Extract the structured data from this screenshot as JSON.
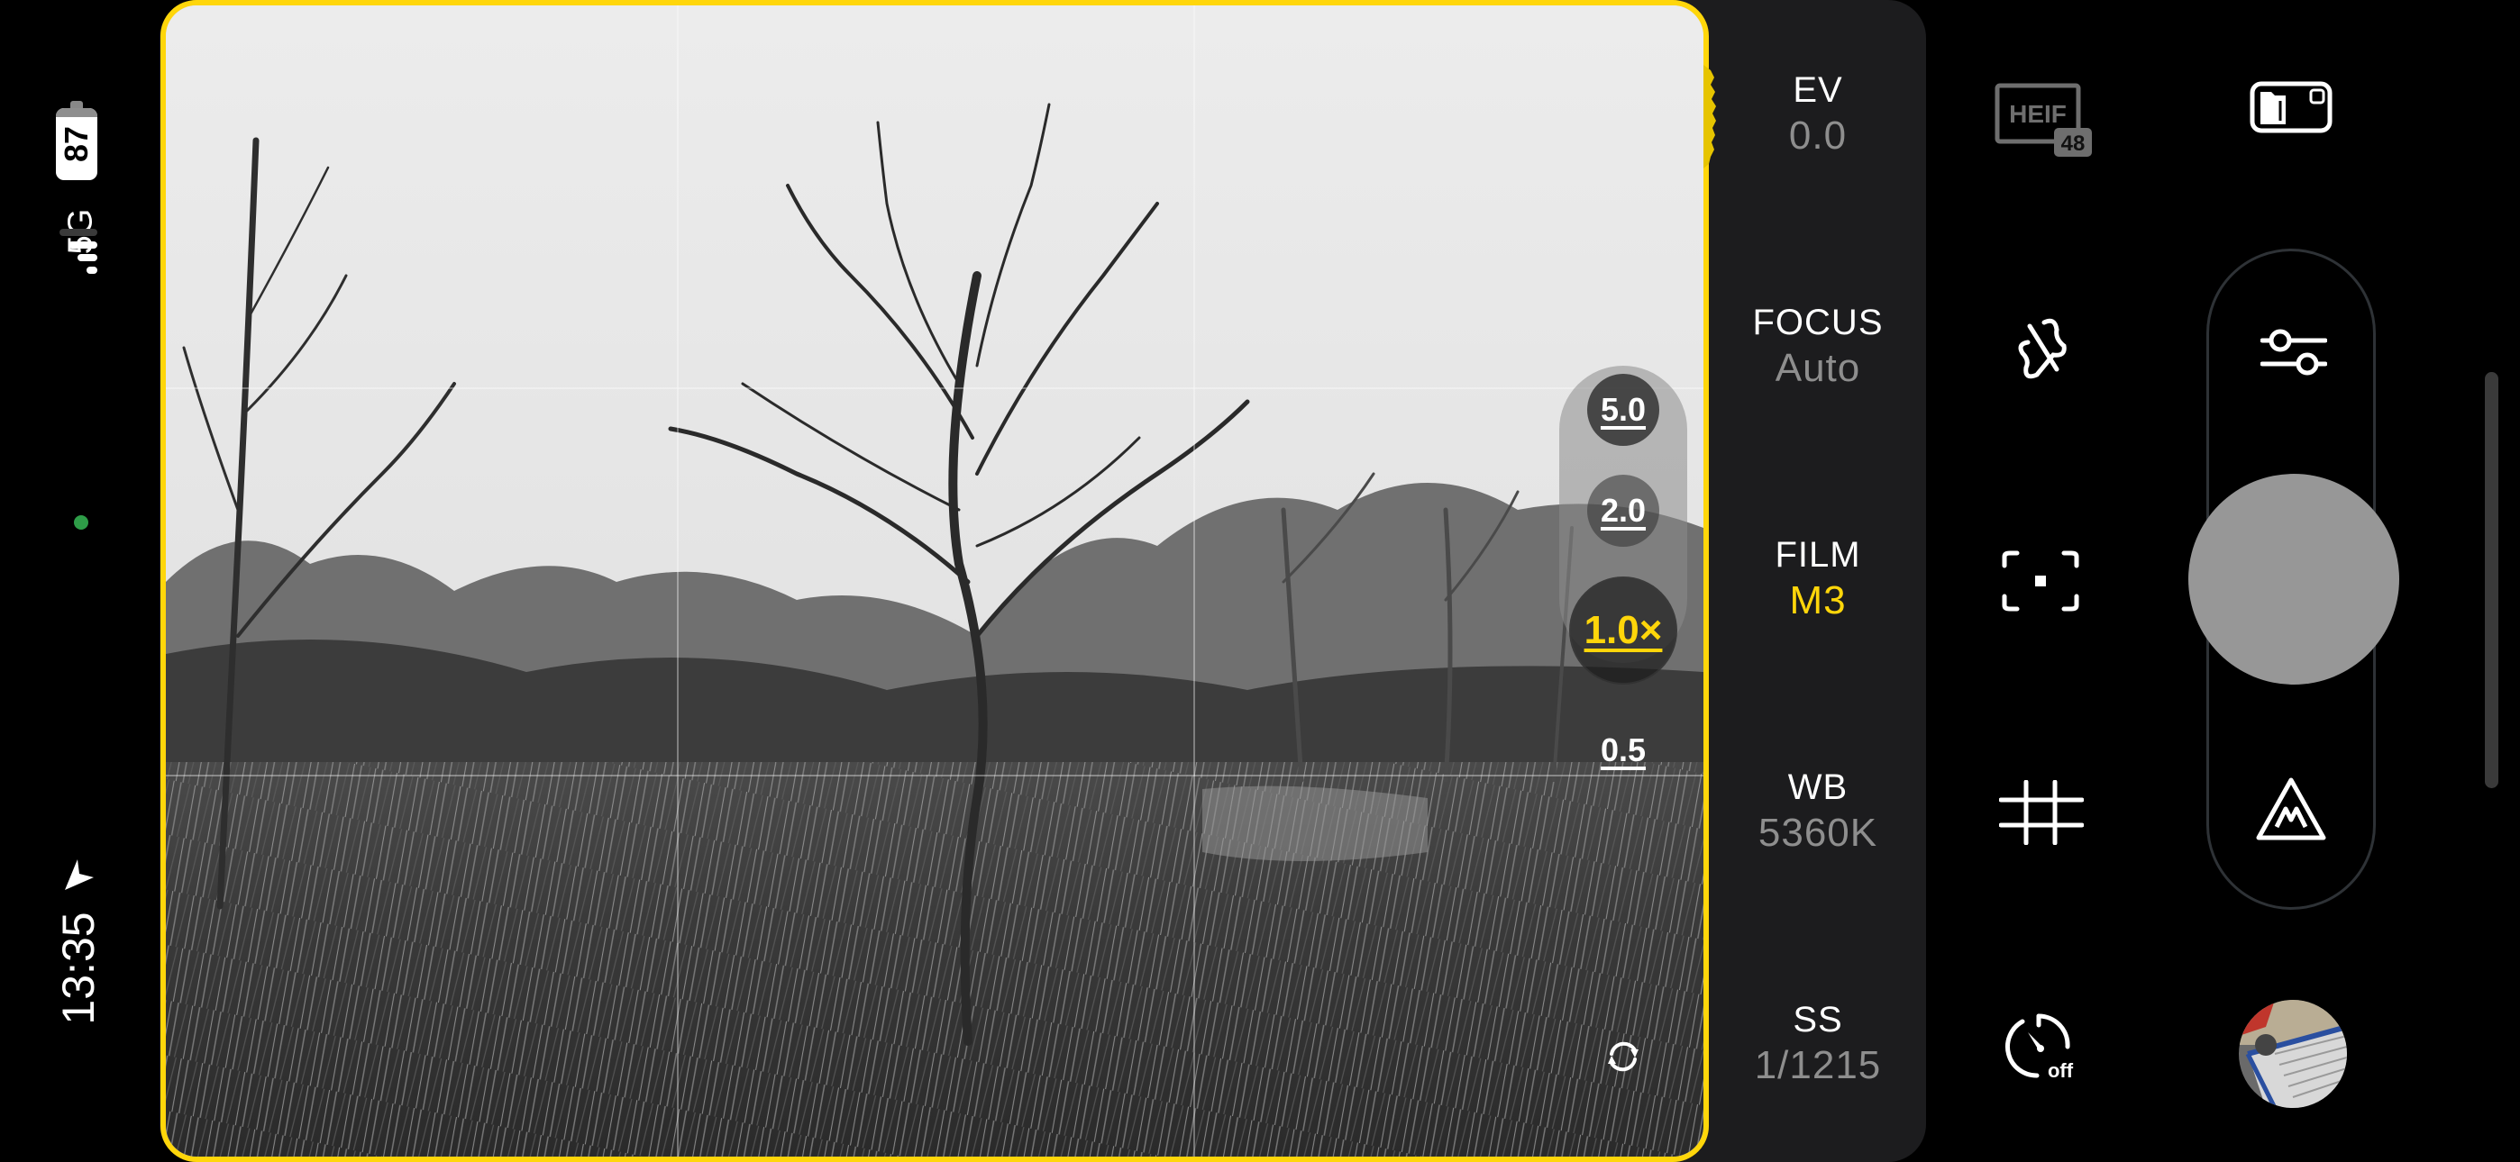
{
  "status_bar": {
    "battery_level": "87",
    "battery_fraction": 0.87,
    "network": "5G",
    "signal_bars_active": 3,
    "signal_bars_total": 4,
    "privacy_indicator_color": "#2e9d48",
    "time": "13:35",
    "location_icon": "location-arrow-icon"
  },
  "viewfinder": {
    "border_color": "#ffd60a",
    "grid": "3x3",
    "scene": "black-and-white winter landscape with bare tree in tall grass"
  },
  "zoom_selector": {
    "options": [
      {
        "label": "5.0",
        "active": false
      },
      {
        "label": "2.0",
        "active": false
      },
      {
        "label": "1.0×",
        "active": true
      },
      {
        "label": "0.5",
        "active": false
      }
    ],
    "active_color": "#ffd60a"
  },
  "flip_camera": {
    "icon": "switch-camera-icon"
  },
  "settings": [
    {
      "label": "EV",
      "value": "0.0",
      "active": false
    },
    {
      "label": "FOCUS",
      "value": "Auto",
      "active": false
    },
    {
      "label": "FILM",
      "value": "M3",
      "active": true
    },
    {
      "label": "WB",
      "value": "5360K",
      "active": false
    },
    {
      "label": "SS",
      "value": "1/1215",
      "active": false
    }
  ],
  "controls": {
    "format_badge": {
      "label": "HEIF",
      "sub": "48"
    },
    "storage_toggle": {
      "icon": "storage-toggle-icon"
    },
    "flash": {
      "icon": "flash-off-icon"
    },
    "focus_mode": {
      "icon": "focus-frame-icon"
    },
    "grid": {
      "icon": "grid-icon"
    },
    "timer": {
      "icon": "timer-icon",
      "label": "off"
    },
    "adjust": {
      "icon": "sliders-icon"
    },
    "shutter": {
      "icon": "shutter-button"
    },
    "mode": {
      "icon": "mountain-m-icon"
    },
    "gallery": {
      "icon": "gallery-thumbnail"
    }
  },
  "colors": {
    "accent": "#ffd60a",
    "panel": "#1c1c1e",
    "muted_text": "#8e8e8e",
    "shutter": "#979797"
  }
}
